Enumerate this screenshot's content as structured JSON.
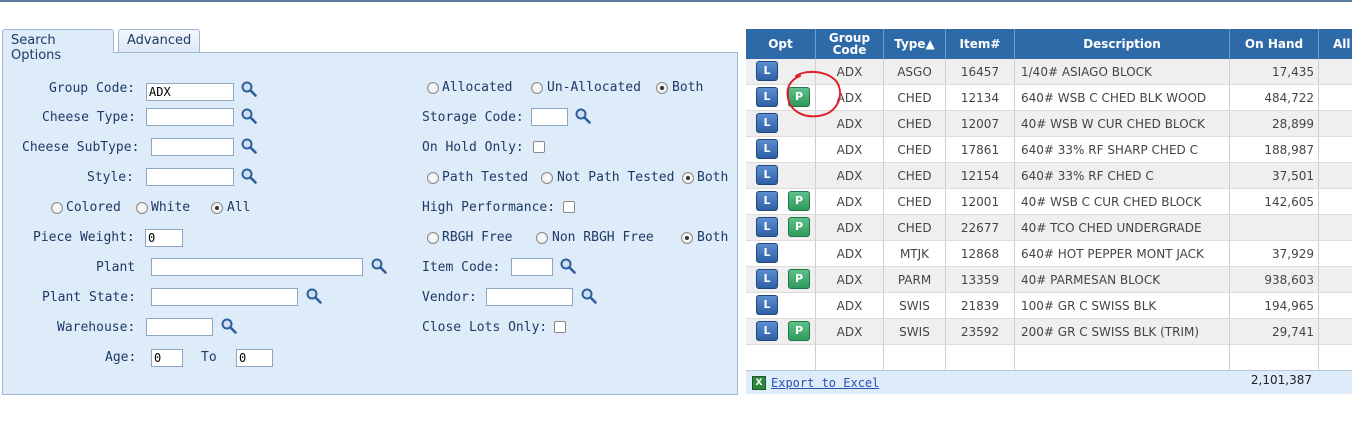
{
  "tabs": {
    "search_options": "Search Options",
    "advanced": "Advanced"
  },
  "left_form": {
    "group_code_label": "Group Code:",
    "group_code_value": "ADX",
    "cheese_type_label": "Cheese Type:",
    "cheese_subtype_label": "Cheese SubType:",
    "style_label": "Style:",
    "colored_label": "Colored",
    "white_label": "White",
    "all_label": "All",
    "piece_weight_label": "Piece Weight:",
    "piece_weight_value": "0",
    "plant_label": "Plant",
    "plant_state_label": "Plant State:",
    "warehouse_label": "Warehouse:",
    "age_label": "Age:",
    "age_from_value": "0",
    "to_label": "To",
    "age_to_value": "0"
  },
  "right_form": {
    "allocated_label": "Allocated",
    "unallocated_label": "Un-Allocated",
    "both_label": "Both",
    "storage_code_label": "Storage Code:",
    "on_hold_label": "On Hold Only:",
    "path_tested_label": "Path Tested",
    "not_path_tested_label": "Not Path Tested",
    "both_label_2": "Both",
    "high_perf_label": "High Performance:",
    "rbgh_free_label": "RBGH Free",
    "non_rbgh_free_label": "Non RBGH Free",
    "both_label_3": "Both",
    "item_code_label": "Item Code:",
    "vendor_label": "Vendor:",
    "close_lots_label": "Close Lots Only:"
  },
  "grid": {
    "headers": {
      "opt": "Opt",
      "group_code_1": "Group",
      "group_code_2": "Code",
      "type": "Type▲",
      "item": "Item#",
      "description": "Description",
      "on_hand": "On Hand",
      "all": "All"
    },
    "rows": [
      {
        "l": "L",
        "p": "",
        "group": "ADX",
        "type": "ASGO",
        "item": "16457",
        "description": "1/40# ASIAGO BLOCK",
        "on_hand": "17,435"
      },
      {
        "l": "L",
        "p": "P",
        "group": "ADX",
        "type": "CHED",
        "item": "12134",
        "description": "640# WSB C CHED BLK WOOD",
        "on_hand": "484,722"
      },
      {
        "l": "L",
        "p": "",
        "group": "ADX",
        "type": "CHED",
        "item": "12007",
        "description": "40# WSB W CUR CHED BLOCK",
        "on_hand": "28,899"
      },
      {
        "l": "L",
        "p": "",
        "group": "ADX",
        "type": "CHED",
        "item": "17861",
        "description": "640# 33% RF SHARP CHED C",
        "on_hand": "188,987"
      },
      {
        "l": "L",
        "p": "",
        "group": "ADX",
        "type": "CHED",
        "item": "12154",
        "description": "640# 33% RF CHED C",
        "on_hand": "37,501"
      },
      {
        "l": "L",
        "p": "P",
        "group": "ADX",
        "type": "CHED",
        "item": "12001",
        "description": "40# WSB C CUR CHED BLOCK",
        "on_hand": "142,605"
      },
      {
        "l": "L",
        "p": "P",
        "group": "ADX",
        "type": "CHED",
        "item": "22677",
        "description": "40# TCO CHED UNDERGRADE",
        "on_hand": ""
      },
      {
        "l": "L",
        "p": "",
        "group": "ADX",
        "type": "MTJK",
        "item": "12868",
        "description": "640# HOT PEPPER MONT JACK",
        "on_hand": "37,929"
      },
      {
        "l": "L",
        "p": "P",
        "group": "ADX",
        "type": "PARM",
        "item": "13359",
        "description": "40# PARMESAN BLOCK",
        "on_hand": "938,603"
      },
      {
        "l": "L",
        "p": "",
        "group": "ADX",
        "type": "SWIS",
        "item": "21839",
        "description": "100# GR C SWISS BLK",
        "on_hand": "194,965"
      },
      {
        "l": "L",
        "p": "P",
        "group": "ADX",
        "type": "SWIS",
        "item": "23592",
        "description": "200# GR C SWISS BLK (TRIM)",
        "on_hand": "29,741"
      }
    ],
    "export_label": "Export to Excel",
    "excel_icon_text": "X",
    "total": "2,101,387"
  },
  "colors": {
    "header_blue": "#2f6aa8",
    "panel_bg": "#deebf9",
    "annotation_red": "#e0202a"
  }
}
